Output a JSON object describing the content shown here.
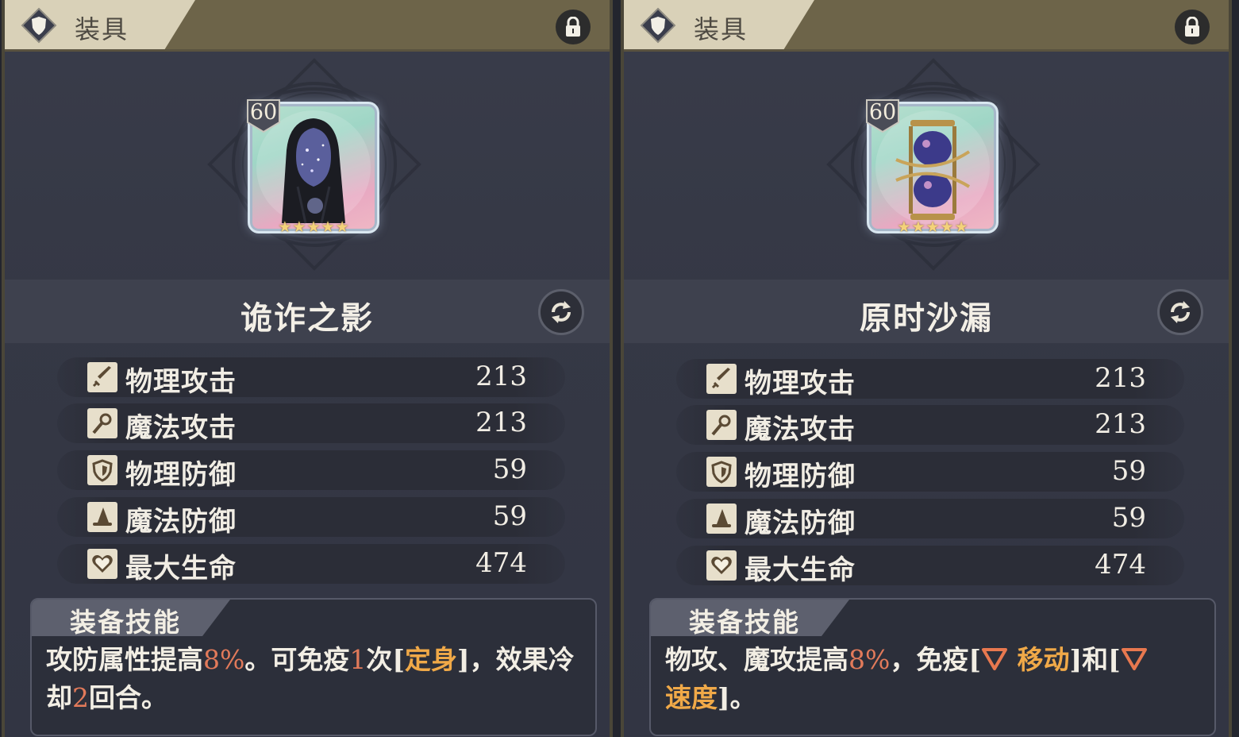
{
  "panels": [
    {
      "header": {
        "title": "装具",
        "shield_icon": "shield-icon",
        "lock_icon": "lock-icon"
      },
      "item": {
        "level": "60",
        "stars": 5,
        "art": "hooded-cloak-icon",
        "name": "诡诈之影"
      },
      "stats": [
        {
          "icon": "sword-icon",
          "label": "物理攻击",
          "value": "213"
        },
        {
          "icon": "wand-icon",
          "label": "魔法攻击",
          "value": "213"
        },
        {
          "icon": "shield-icon",
          "label": "物理防御",
          "value": "59"
        },
        {
          "icon": "wizard-hat-icon",
          "label": "魔法防御",
          "value": "59"
        },
        {
          "icon": "heart-icon",
          "label": "最大生命",
          "value": "474"
        }
      ],
      "skill": {
        "title": "装备技能",
        "text": {
          "t1": "攻防属性提高",
          "n1": "8%",
          "t2": "。可免疫",
          "n2": "1",
          "t3": "次[",
          "k1": "定身",
          "t4": "]，效果冷却",
          "n3": "2",
          "t5": "回合。"
        }
      }
    },
    {
      "header": {
        "title": "装具",
        "shield_icon": "shield-icon",
        "lock_icon": "lock-icon"
      },
      "item": {
        "level": "60",
        "stars": 5,
        "art": "hourglass-icon",
        "name": "原时沙漏"
      },
      "stats": [
        {
          "icon": "sword-icon",
          "label": "物理攻击",
          "value": "213"
        },
        {
          "icon": "wand-icon",
          "label": "魔法攻击",
          "value": "213"
        },
        {
          "icon": "shield-icon",
          "label": "物理防御",
          "value": "59"
        },
        {
          "icon": "wizard-hat-icon",
          "label": "魔法防御",
          "value": "59"
        },
        {
          "icon": "heart-icon",
          "label": "最大生命",
          "value": "474"
        }
      ],
      "skill": {
        "title": "装备技能",
        "text": {
          "t1": "物攻、魔攻提高",
          "n1": "8%",
          "t2": "，免疫[",
          "k1": "移动",
          "t3": "]和[",
          "k2": "速度",
          "t4": "]。"
        }
      }
    }
  ],
  "colors": {
    "header_bar": "#6d6449",
    "header_tab": "#d9d1b8",
    "highlight_number": "#e27a5a",
    "highlight_keyword": "#f0a948",
    "debuff_triangle": "#e8784f"
  }
}
